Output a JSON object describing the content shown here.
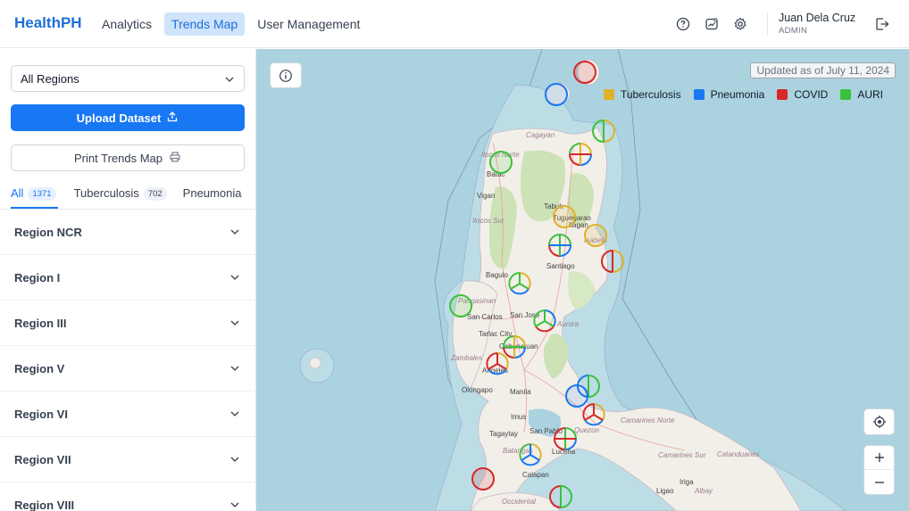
{
  "brand": "HealthPH",
  "nav": [
    {
      "label": "Analytics",
      "active": false
    },
    {
      "label": "Trends Map",
      "active": true
    },
    {
      "label": "User Management",
      "active": false
    }
  ],
  "user": {
    "name": "Juan Dela Cruz",
    "role": "ADMIN"
  },
  "icons": {
    "help": "question-circle-icon",
    "trends": "chart-icon",
    "settings": "gear-icon",
    "logout": "logout-icon"
  },
  "sidebar": {
    "region_select": {
      "value": "All Regions"
    },
    "upload_label": "Upload Dataset",
    "print_label": "Print Trends Map",
    "tabs": [
      {
        "label": "All",
        "count": "1371"
      },
      {
        "label": "Tuberculosis",
        "count": "702"
      },
      {
        "label": "Pneumonia",
        "count": ""
      }
    ],
    "regions": [
      "Region NCR",
      "Region I",
      "Region III",
      "Region V",
      "Region VI",
      "Region VII",
      "Region VIII"
    ]
  },
  "map": {
    "updated": "Updated as of July 11, 2024",
    "legend": [
      {
        "label": "Tuberculosis",
        "color": "#e0b12a"
      },
      {
        "label": "Pneumonia",
        "color": "#1877f2"
      },
      {
        "label": "COVID",
        "color": "#d62828"
      },
      {
        "label": "AURI",
        "color": "#3cc13b"
      }
    ],
    "labels": {
      "cagayan": "Cagayan",
      "ilocos_norte": "Ilocos Norte",
      "batac": "Batac",
      "vigan": "Vigan",
      "tuguegarao": "Tuguegarao",
      "tabuk": "Tabuk",
      "ilocos_sur": "Ilocos Sur",
      "ilagan": "Ilagan",
      "isabela": "Isabela",
      "santiago": "Santiago",
      "baguio": "Baguio",
      "pangasinan": "Pangasinan",
      "san_carlos": "San Carlos",
      "san_jose": "San Jose",
      "aurora": "Aurora",
      "tarlac_city": "Tarlac City",
      "cabanatuan": "Cabanatuan",
      "zambales": "Zambales",
      "angeles": "Angeles",
      "olongapo": "Olongapo",
      "manila": "Manila",
      "imus": "Imus",
      "tagaytay": "Tagaytay",
      "san_pablo": "San Pablo",
      "quezon": "Quezon",
      "batangas": "Batangas",
      "lucena": "Lucena",
      "calapan": "Calapan",
      "camarines_norte": "Camarines Norte",
      "camarines_sur": "Camarines Sur",
      "catanduanes": "Catanduanes",
      "iriga": "Iriga",
      "ligao": "Ligao",
      "albay": "Albay",
      "occidental": "Occidental"
    }
  }
}
